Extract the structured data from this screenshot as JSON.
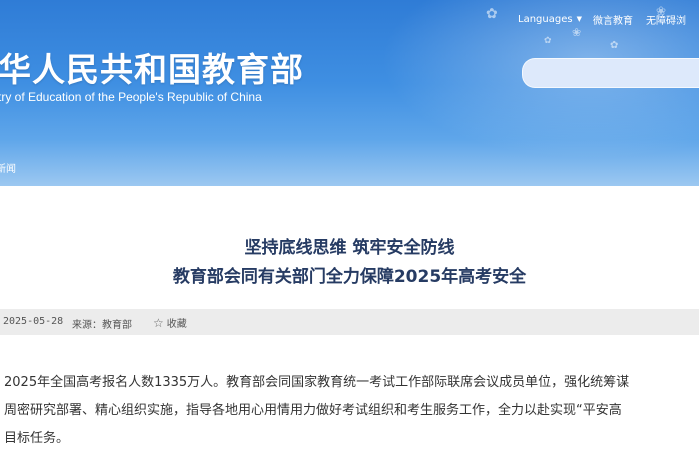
{
  "header": {
    "title_cn": "华人民共和国教育部",
    "title_en": "try of Education of the People's Republic of China",
    "links": {
      "languages": "Languages",
      "weibo": "微言教育",
      "accessibility": "无障碍浏"
    },
    "search": {
      "placeholder": ""
    },
    "nav": {
      "item": "新闻"
    }
  },
  "article": {
    "title_line1": "坚持底线思维 筑牢安全防线",
    "title_line2": "教育部会同有关部门全力保障2025年高考安全",
    "date": "2025-05-28",
    "source": "来源：教育部",
    "favorite": "收藏",
    "paragraph_lines": [
      "2025年全国高考报名人数1335万人。教育部会同国家教育统一考试工作部际联席会议成员单位，强化统筹谋",
      "周密研究部署、精心组织实施，指导各地用心用情用力做好考试组织和考生服务工作，全力以赴实现“平安高",
      "目标任务。"
    ]
  },
  "colors": {
    "header_blue": "#3f8fe2",
    "title_navy": "#263b63",
    "meta_bg": "#ececec"
  },
  "icons": {
    "caret": "chevron-down-icon",
    "favorite": "star-icon"
  }
}
